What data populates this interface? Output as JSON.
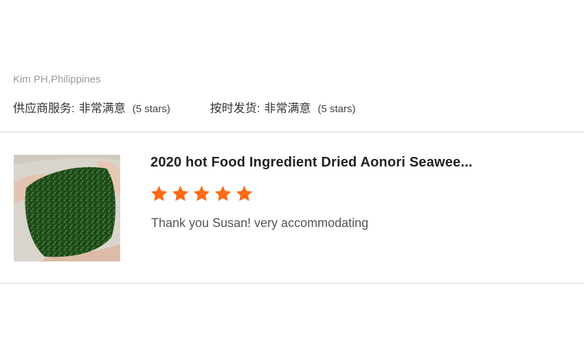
{
  "reviewer": {
    "name_location": "Kim PH,Philippines"
  },
  "ratings": [
    {
      "label": "供应商服务:",
      "value": "非常满意",
      "note": "(5 stars)"
    },
    {
      "label": "按时发货:",
      "value": "非常满意",
      "note": "(5 stars)"
    }
  ],
  "product": {
    "title": "2020 hot Food Ingredient Dried Aonori Seawee...",
    "star_rating": 5,
    "star_color": "#ff6a14",
    "comment": "Thank you Susan! very accommodating"
  }
}
